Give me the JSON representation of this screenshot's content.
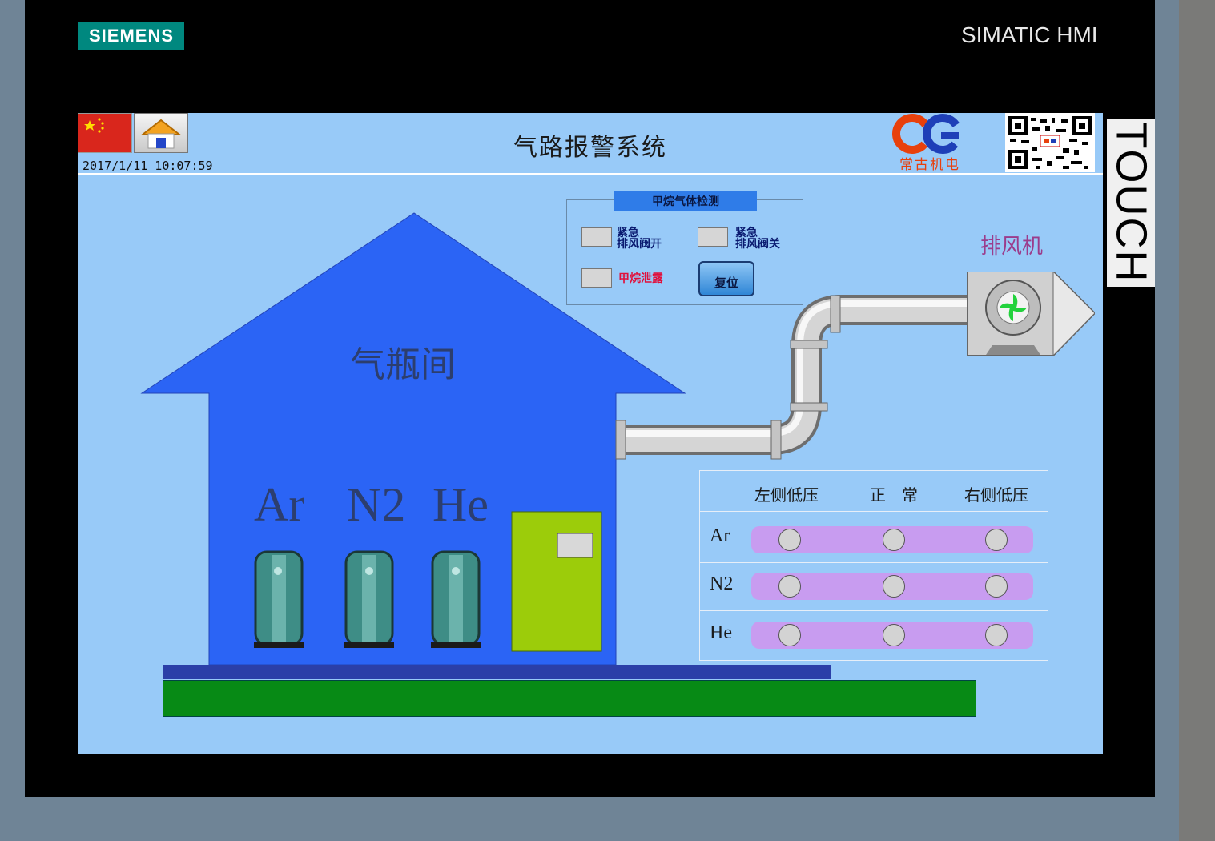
{
  "bezel": {
    "brand": "SIEMENS",
    "model": "SIMATIC HMI",
    "touch": "TOUCH"
  },
  "header": {
    "title": "气路报警系统",
    "datetime": "2017/1/11  10:07:59",
    "logo_text": "常古机电"
  },
  "room": {
    "label": "气瓶间",
    "gases": [
      "Ar",
      "N2",
      "He"
    ]
  },
  "methane_panel": {
    "title": "甲烷气体检测",
    "emergency_open": {
      "line1": "紧急",
      "line2": "排风阀开"
    },
    "emergency_close": {
      "line1": "紧急",
      "line2": "排风阀关"
    },
    "leak_label": "甲烷泄露",
    "reset_label": "复位"
  },
  "fan": {
    "label": "排风机"
  },
  "pressure_table": {
    "columns": [
      "左侧低压",
      "正　常",
      "右侧低压"
    ],
    "rows": [
      "Ar",
      "N2",
      "He"
    ]
  },
  "colors": {
    "screen_bg": "#98caf8",
    "house": "#2b64f5",
    "door": "#9ccc0a",
    "floor": "#078a15",
    "bar": "#c89cf0"
  }
}
